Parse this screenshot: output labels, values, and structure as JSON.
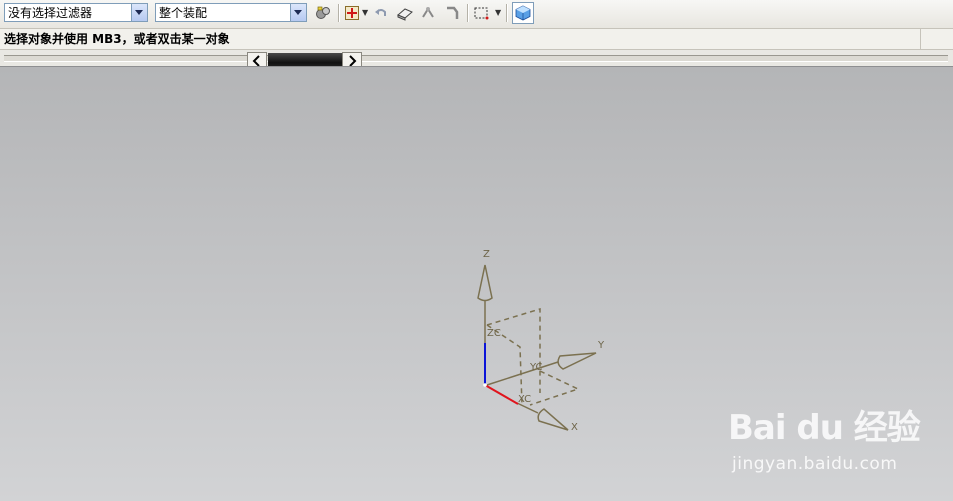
{
  "toolbar": {
    "filter_combo": {
      "value": "没有选择过滤器"
    },
    "scope_combo": {
      "value": "整个装配"
    },
    "icons": [
      "filter-settings-icon",
      "snap-point-icon",
      "undo-selection-icon",
      "eraser-icon",
      "show-hide-icon",
      "select-feature-icon",
      "rectangle-select-icon",
      "view-cube-icon"
    ]
  },
  "status": {
    "prompt": "选择对象并使用 MB3，或者双击某一对象"
  },
  "viewport": {
    "axes": {
      "z": "Z",
      "y": "Y",
      "x": "X",
      "zc": "ZC",
      "yc": "YC",
      "xc": "XC"
    },
    "colors": {
      "triad": "#7b7150",
      "z_axis": "#0b14d8",
      "x_axis": "#e0141c"
    }
  },
  "watermark": {
    "logo": "Bai du 经验",
    "url": "jingyan.baidu.com"
  }
}
